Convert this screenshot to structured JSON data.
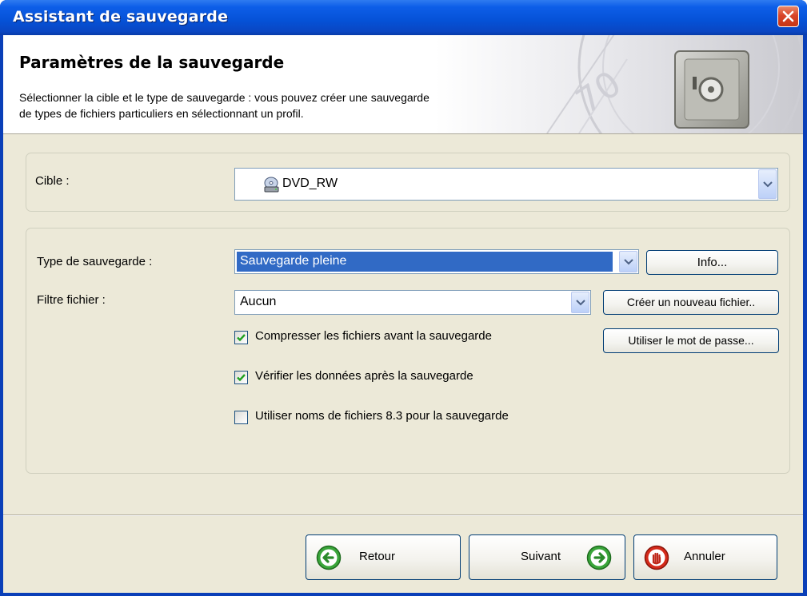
{
  "window": {
    "title": "Assistant de sauvegarde"
  },
  "header": {
    "title": "Paramètres de la sauvegarde",
    "description_line1": "Sélectionner la cible et le type de sauvegarde : vous pouvez créer une sauvegarde",
    "description_line2": "de types de fichiers particuliers en sélectionnant un profil.",
    "art_icon": "safe-icon"
  },
  "target": {
    "label": "Cible :",
    "selected": "DVD_RW",
    "icon": "dvd-drive-icon"
  },
  "options": {
    "type_label": "Type de sauvegarde :",
    "type_selected": "Sauvegarde pleine",
    "info_button": "Info...",
    "filter_label": "Filtre fichier :",
    "filter_selected": "Aucun",
    "new_file_button": "Créer un nouveau fichier..",
    "password_button": "Utiliser le mot de passe...",
    "checkboxes": [
      {
        "label": "Compresser les fichiers avant la sauvegarde",
        "checked": true
      },
      {
        "label": "Vérifier les données après la sauvegarde",
        "checked": true
      },
      {
        "label": "Utiliser noms de fichiers 8.3 pour la sauvegarde",
        "checked": false
      }
    ]
  },
  "footer": {
    "back_button": "Retour",
    "next_button": "Suivant",
    "cancel_button": "Annuler"
  },
  "colors": {
    "titlebar": "#0551d6",
    "dialog_bg": "#ece9d8",
    "selection": "#316ac5",
    "nav_green": "#3aa53a",
    "cancel_red": "#d42a1a"
  }
}
